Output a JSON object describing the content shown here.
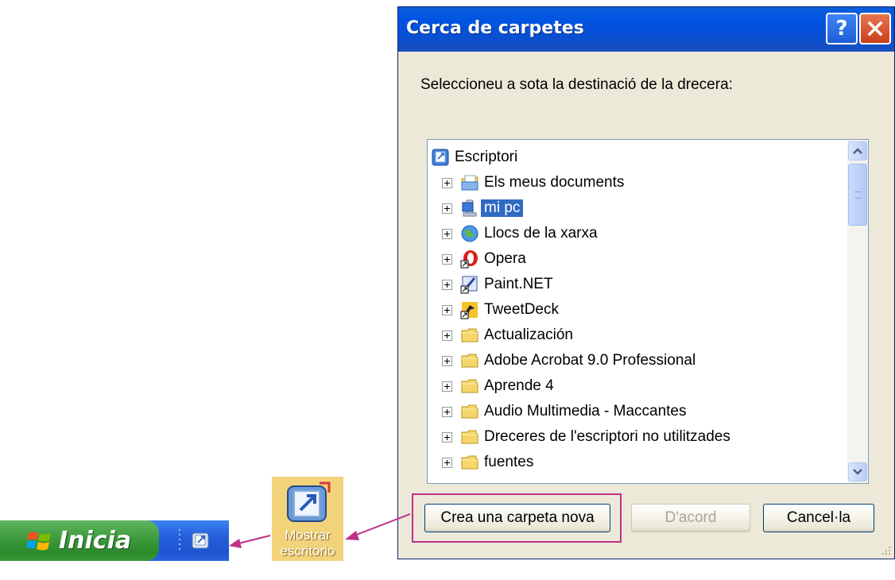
{
  "dialog": {
    "title": "Cerca de carpetes",
    "help_label": "?",
    "prompt": "Seleccioneu a sota la destinació de la drecera:",
    "tree": {
      "root": "Escriptori",
      "items": [
        {
          "label": "Els meus documents",
          "icon": "documents-folder-icon",
          "selected": false
        },
        {
          "label": "mi pc",
          "icon": "computer-icon",
          "selected": true
        },
        {
          "label": "Llocs de la xarxa",
          "icon": "network-places-icon",
          "selected": false
        },
        {
          "label": "Opera",
          "icon": "opera-shortcut-icon",
          "selected": false
        },
        {
          "label": "Paint.NET",
          "icon": "paintnet-shortcut-icon",
          "selected": false
        },
        {
          "label": "TweetDeck",
          "icon": "tweetdeck-shortcut-icon",
          "selected": false
        },
        {
          "label": "Actualización",
          "icon": "folder-icon",
          "selected": false
        },
        {
          "label": "Adobe Acrobat 9.0 Professional",
          "icon": "folder-icon",
          "selected": false
        },
        {
          "label": "Aprende 4",
          "icon": "folder-icon",
          "selected": false
        },
        {
          "label": "Audio Multimedia - Maccantes",
          "icon": "folder-icon",
          "selected": false
        },
        {
          "label": "Dreceres de l'escriptori no utilitzades",
          "icon": "folder-icon",
          "selected": false
        },
        {
          "label": "fuentes",
          "icon": "folder-icon",
          "selected": false
        }
      ]
    },
    "buttons": {
      "new_folder": "Crea una carpeta nova",
      "ok": "D'acord",
      "cancel": "Cancel·la"
    }
  },
  "taskbar": {
    "start_label": "Inicia"
  },
  "show_desktop": {
    "line1": "Mostrar",
    "line2": "escritorio"
  },
  "colors": {
    "annotation": "#c0308a",
    "selection": "#316ac5",
    "titlebar": "#0054e3"
  }
}
